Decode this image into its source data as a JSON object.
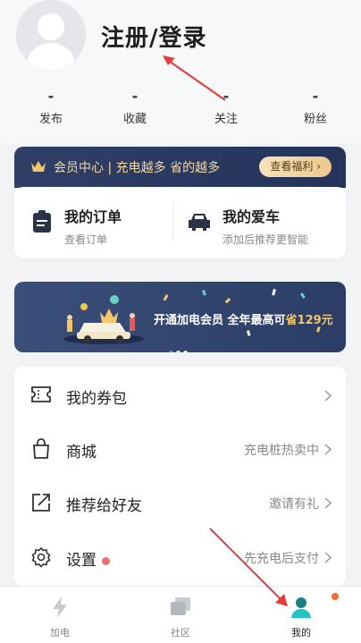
{
  "header": {
    "login_label": "注册/登录"
  },
  "stats": [
    {
      "value": "-",
      "label": "发布"
    },
    {
      "value": "-",
      "label": "收藏"
    },
    {
      "value": "-",
      "label": "关注"
    },
    {
      "value": "-",
      "label": "粉丝"
    }
  ],
  "vip": {
    "text": "会员中心 | 充电越多 省的越多",
    "button": "查看福利 ›"
  },
  "quick": [
    {
      "title": "我的订单",
      "sub": "查看订单",
      "icon": "order-clipboard-icon"
    },
    {
      "title": "我的爱车",
      "sub": "添加后推荐更智能",
      "icon": "car-icon"
    }
  ],
  "banner": {
    "text_prefix": "开通加电会员 全年最高可",
    "text_highlight": "省129元"
  },
  "menu": [
    {
      "label": "我的券包",
      "right": "",
      "icon": "coupon-icon"
    },
    {
      "label": "商城",
      "right": "充电桩热卖中",
      "icon": "shopping-bag-icon"
    },
    {
      "label": "推荐给好友",
      "right": "邀请有礼",
      "icon": "share-icon"
    },
    {
      "label": "设置",
      "right": "先充电后支付",
      "icon": "settings-gear-icon"
    }
  ],
  "tabs": [
    {
      "label": "加电",
      "icon": "lightning-icon",
      "active": false
    },
    {
      "label": "社区",
      "icon": "community-icon",
      "active": false
    },
    {
      "label": "我的",
      "icon": "profile-icon",
      "active": true
    }
  ],
  "colors": {
    "accent": "#24c4c4",
    "vip_bg": "#2f3f66",
    "gold": "#f4d9a8",
    "red_dot": "#f07070",
    "tab_dot": "#f26a2e"
  }
}
